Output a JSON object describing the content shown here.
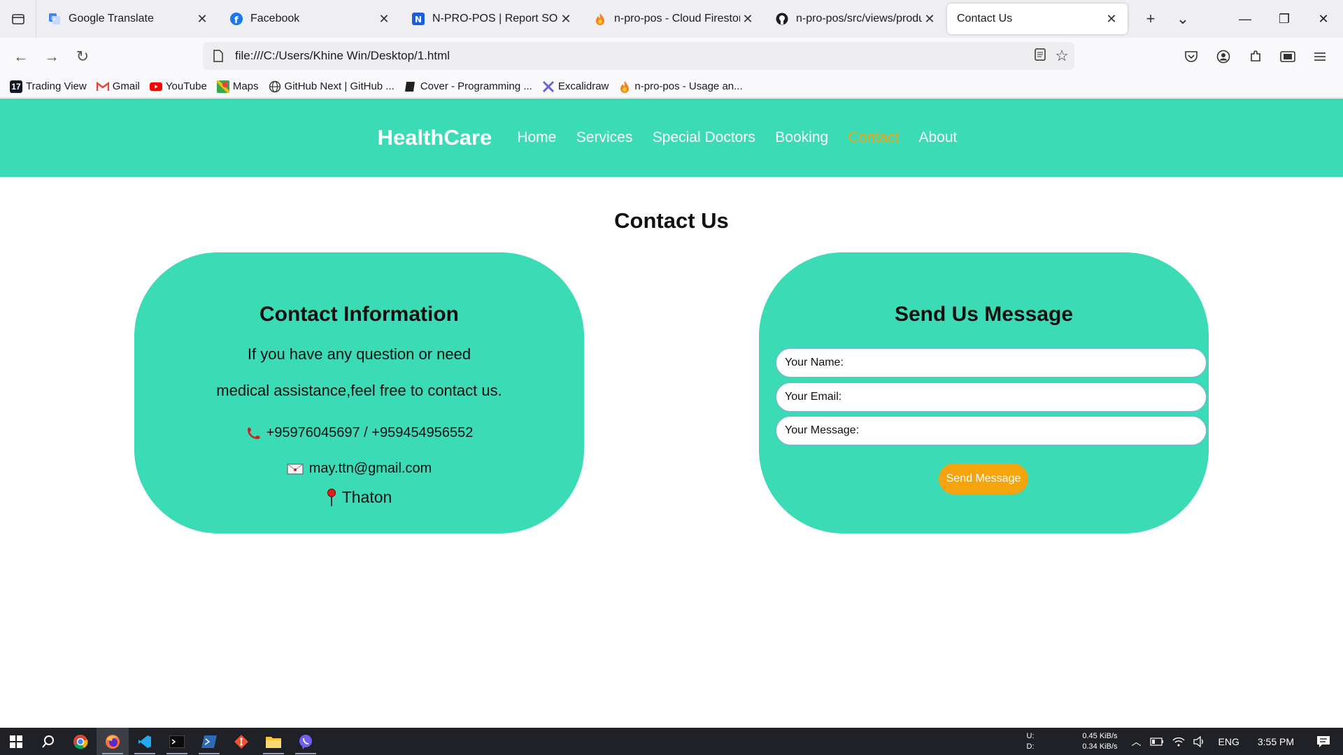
{
  "browser": {
    "tabs": [
      {
        "title": "Google Translate",
        "icon": "google-translate-icon",
        "active": false
      },
      {
        "title": "Facebook",
        "icon": "facebook-icon",
        "active": false
      },
      {
        "title": "N-PRO-POS | Report SOC",
        "icon": "notion-icon",
        "active": false
      },
      {
        "title": "n-pro-pos - Cloud Firestore",
        "icon": "firebase-icon",
        "active": false
      },
      {
        "title": "n-pro-pos/src/views/produc",
        "icon": "github-icon",
        "active": false
      },
      {
        "title": "Contact Us",
        "icon": "",
        "active": true
      }
    ],
    "url": "file:///C:/Users/Khine Win/Desktop/1.html",
    "bookmarks": [
      {
        "label": "Trading View",
        "icon": "tradingview-icon"
      },
      {
        "label": "Gmail",
        "icon": "gmail-icon"
      },
      {
        "label": "YouTube",
        "icon": "youtube-icon"
      },
      {
        "label": "Maps",
        "icon": "maps-icon"
      },
      {
        "label": "GitHub Next | GitHub ...",
        "icon": "globe-icon"
      },
      {
        "label": "Cover - Programming ...",
        "icon": "book-icon"
      },
      {
        "label": "Excalidraw",
        "icon": "excalidraw-icon"
      },
      {
        "label": "n-pro-pos - Usage an...",
        "icon": "firebase-icon"
      }
    ]
  },
  "site": {
    "brand": "HealthCare",
    "nav": [
      {
        "label": "Home",
        "current": false
      },
      {
        "label": "Services",
        "current": false
      },
      {
        "label": "Special Doctors",
        "current": false
      },
      {
        "label": "Booking",
        "current": false
      },
      {
        "label": "Contact",
        "current": true
      },
      {
        "label": "About",
        "current": false
      }
    ],
    "accent_color": "#3bdbb6",
    "highlight_color": "#f5a40b"
  },
  "main": {
    "title": "Contact Us",
    "info": {
      "heading": "Contact Information",
      "line1": "If you have any question or need",
      "line2": "medical assistance,feel free to contact us.",
      "phone": "+95976045697 / +959454956552",
      "email": "may.ttn@gmail.com",
      "location": "Thaton"
    },
    "form": {
      "heading": "Send Us Message",
      "name_placeholder": "Your Name:",
      "email_placeholder": "Your Email:",
      "message_placeholder": "Your Message:",
      "button": "Send Message"
    }
  },
  "taskbar": {
    "net_up_label": "U:",
    "net_down_label": "D:",
    "net_up": "0.45 KiB/s",
    "net_down": "0.34 KiB/s",
    "language": "ENG",
    "time": "3:55 PM"
  }
}
